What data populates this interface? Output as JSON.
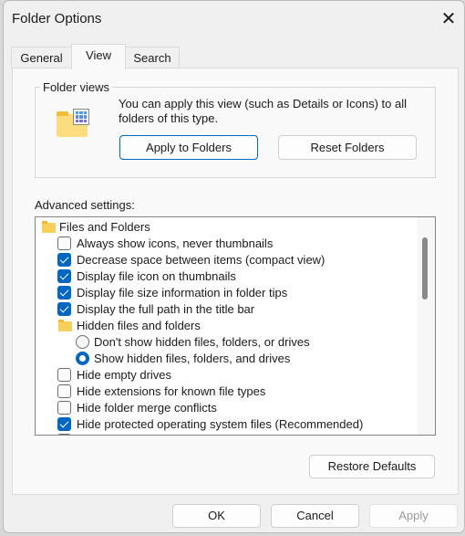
{
  "window": {
    "title": "Folder Options",
    "close_icon": "close-icon"
  },
  "tabs": [
    {
      "label": "General"
    },
    {
      "label": "View",
      "active": true
    },
    {
      "label": "Search"
    }
  ],
  "folder_views": {
    "legend": "Folder views",
    "description": "You can apply this view (such as Details or Icons) to all folders of this type.",
    "apply_label": "Apply to Folders",
    "reset_label": "Reset Folders"
  },
  "advanced": {
    "label": "Advanced settings:",
    "items": [
      {
        "type": "folder",
        "label": "Files and Folders"
      },
      {
        "type": "checkbox",
        "label": "Always show icons, never thumbnails",
        "checked": false
      },
      {
        "type": "checkbox",
        "label": "Decrease space between items (compact view)",
        "checked": true
      },
      {
        "type": "checkbox",
        "label": "Display file icon on thumbnails",
        "checked": true
      },
      {
        "type": "checkbox",
        "label": "Display file size information in folder tips",
        "checked": true
      },
      {
        "type": "checkbox",
        "label": "Display the full path in the title bar",
        "checked": true
      },
      {
        "type": "folder",
        "label": "Hidden files and folders"
      },
      {
        "type": "radio",
        "label": "Don't show hidden files, folders, or drives",
        "checked": false
      },
      {
        "type": "radio",
        "label": "Show hidden files, folders, and drives",
        "checked": true
      },
      {
        "type": "checkbox",
        "label": "Hide empty drives",
        "checked": false
      },
      {
        "type": "checkbox",
        "label": "Hide extensions for known file types",
        "checked": false
      },
      {
        "type": "checkbox",
        "label": "Hide folder merge conflicts",
        "checked": false
      },
      {
        "type": "checkbox",
        "label": "Hide protected operating system files (Recommended)",
        "checked": true
      }
    ]
  },
  "restore_label": "Restore Defaults",
  "buttons": {
    "ok": "OK",
    "cancel": "Cancel",
    "apply": "Apply"
  },
  "colors": {
    "accent": "#0067c0"
  }
}
